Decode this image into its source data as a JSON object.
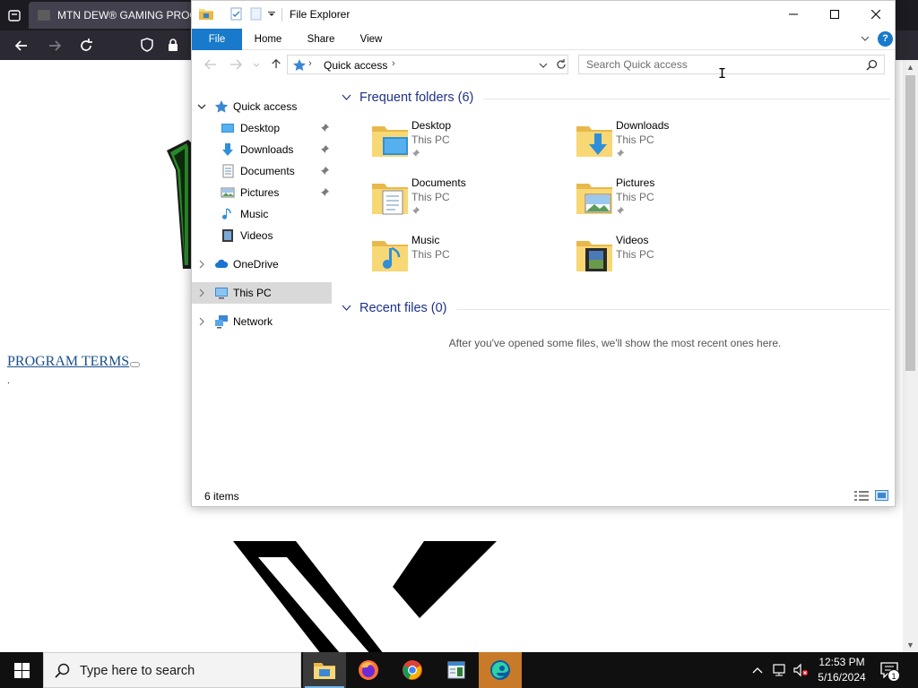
{
  "browser": {
    "tab_title": "MTN DEW® GAMING PROG",
    "page_link": "PROGRAM TERMS",
    "page_dot": "."
  },
  "explorer": {
    "title": "File Explorer",
    "ribbon_tabs": [
      "File",
      "Home",
      "Share",
      "View"
    ],
    "help": "?",
    "address": {
      "location": "Quick access"
    },
    "search": {
      "placeholder": "Search Quick access",
      "value": ""
    },
    "nav_pane": [
      {
        "label": "Quick access",
        "icon": "star-icon",
        "expanded": true
      },
      {
        "label": "Desktop",
        "icon": "desktop-icon",
        "pinned": true
      },
      {
        "label": "Downloads",
        "icon": "downloads-icon",
        "pinned": true
      },
      {
        "label": "Documents",
        "icon": "documents-icon",
        "pinned": true
      },
      {
        "label": "Pictures",
        "icon": "pictures-icon",
        "pinned": true
      },
      {
        "label": "Music",
        "icon": "music-icon"
      },
      {
        "label": "Videos",
        "icon": "videos-icon"
      },
      {
        "label": "OneDrive",
        "icon": "onedrive-icon"
      },
      {
        "label": "This PC",
        "icon": "this-pc-icon",
        "selected": true
      },
      {
        "label": "Network",
        "icon": "network-icon"
      }
    ],
    "frequent": {
      "header": "Frequent folders (6)",
      "folders": [
        {
          "name": "Desktop",
          "location": "This PC",
          "pinned": true
        },
        {
          "name": "Downloads",
          "location": "This PC",
          "pinned": true
        },
        {
          "name": "Documents",
          "location": "This PC",
          "pinned": true
        },
        {
          "name": "Pictures",
          "location": "This PC",
          "pinned": true
        },
        {
          "name": "Music",
          "location": "This PC",
          "pinned": false
        },
        {
          "name": "Videos",
          "location": "This PC",
          "pinned": false
        }
      ]
    },
    "recent": {
      "header": "Recent files (0)",
      "empty_message": "After you've opened some files, we'll show the most recent ones here."
    },
    "status": "6 items"
  },
  "taskbar": {
    "search_text": "Type here to search",
    "apps": [
      "file-explorer-icon",
      "firefox-icon",
      "chrome-icon",
      "notepad-icon",
      "edge-icon"
    ],
    "clock": {
      "time": "12:53 PM",
      "date": "5/16/2024"
    },
    "notification_count": "1"
  },
  "colors": {
    "accent": "#1979ca",
    "group_header": "#1e3287",
    "folder_yellow": "#f8d775",
    "taskbar": "#101010"
  }
}
